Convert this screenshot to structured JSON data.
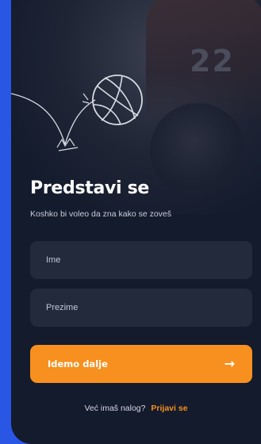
{
  "hero": {
    "jersey_number": "22",
    "illustration": "bouncing-basketball-doodle"
  },
  "form": {
    "title": "Predstavi se",
    "subtitle": "Koshko bi voleo da zna kako se zoveš",
    "first_name": {
      "placeholder": "Ime",
      "value": ""
    },
    "last_name": {
      "placeholder": "Prezime",
      "value": ""
    },
    "submit_label": "Idemo dalje",
    "submit_icon": "arrow-right-icon"
  },
  "footer": {
    "prompt": "Već imaš nalog?",
    "login_label": "Prijavi se"
  },
  "colors": {
    "background": "#2a56e6",
    "screen": "#141b2d",
    "field": "#222a3b",
    "accent": "#f7901e",
    "text": "#ffffff"
  }
}
